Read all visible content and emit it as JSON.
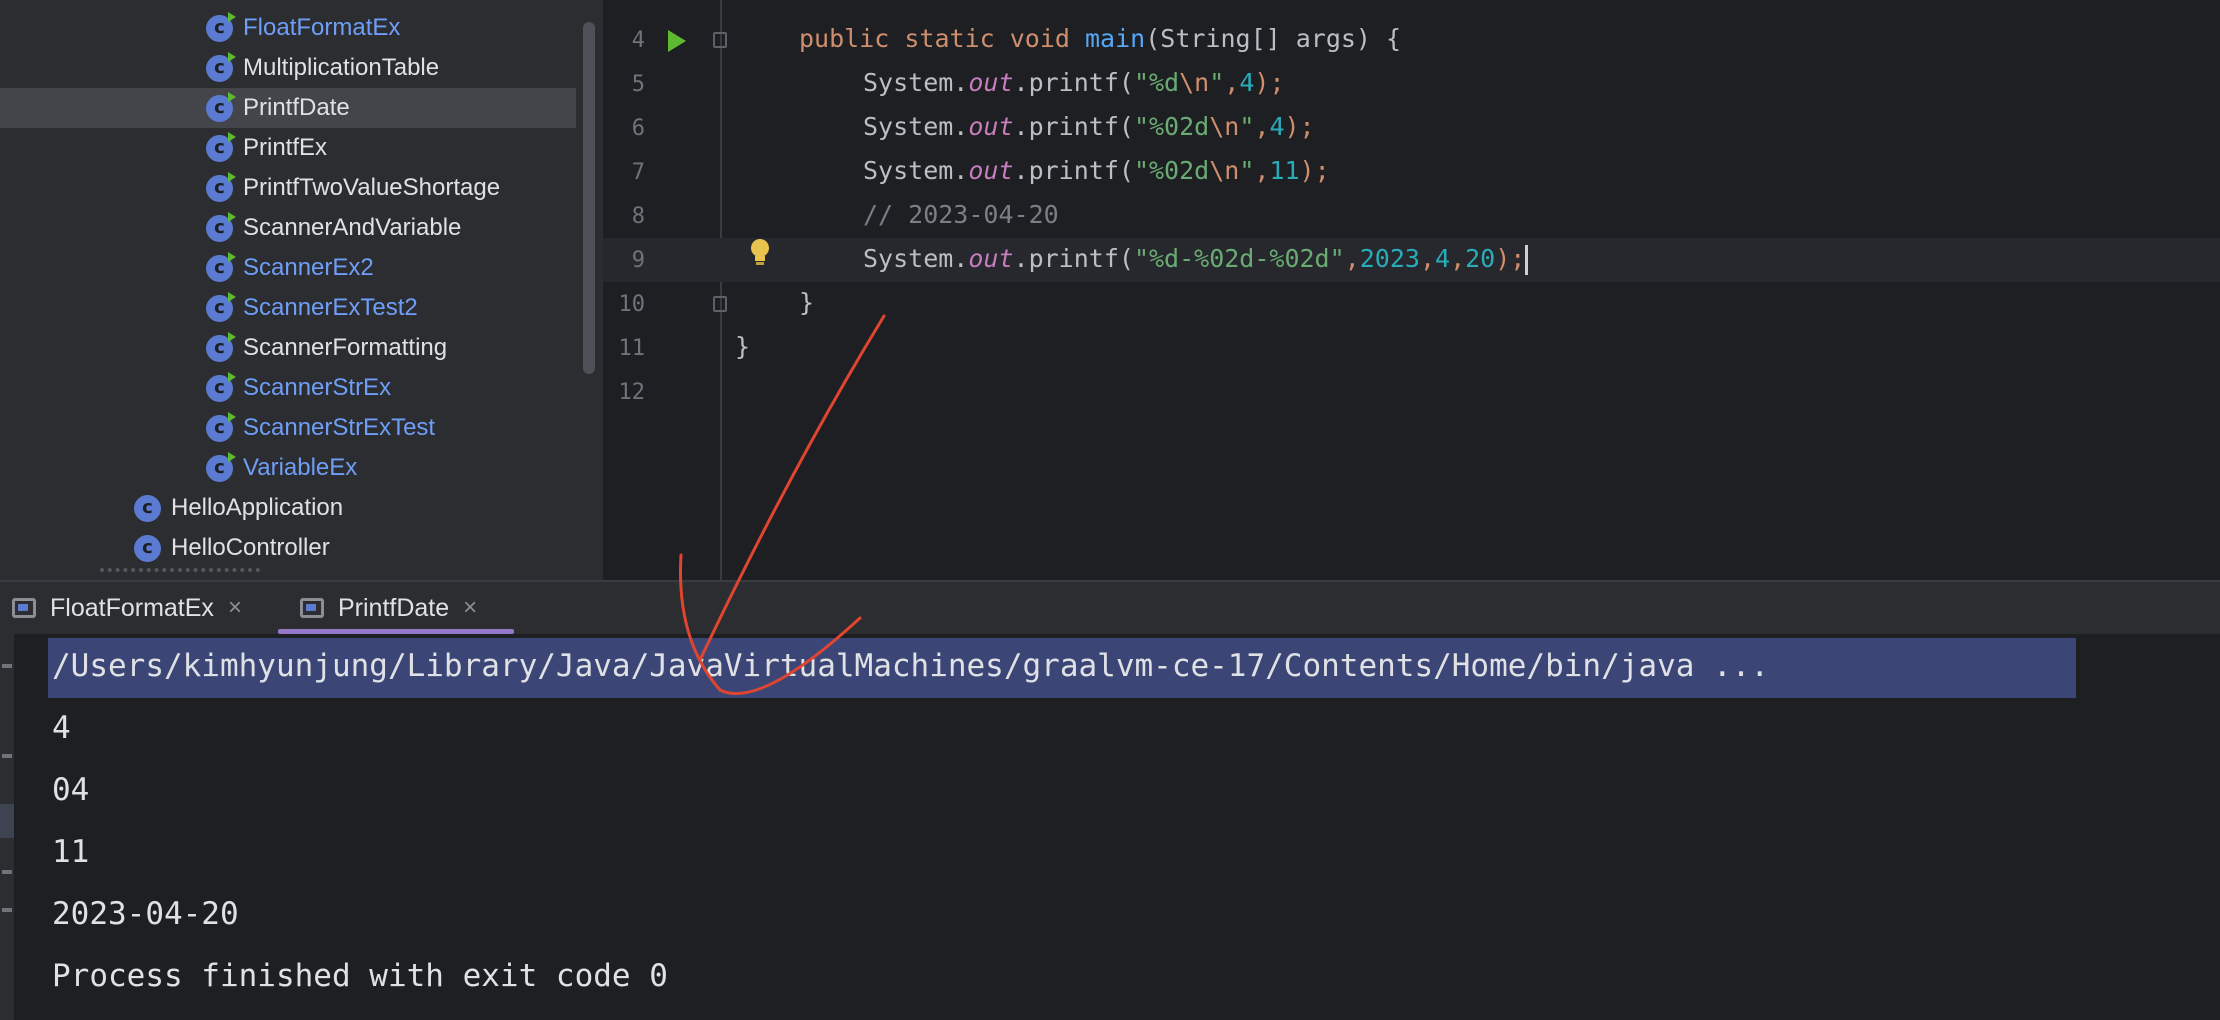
{
  "project_tree": {
    "items": [
      {
        "label": "FloatFormatEx",
        "color": "#6f9ef8",
        "runnable": true,
        "indent": 1
      },
      {
        "label": "MultiplicationTable",
        "color": "#dfe1e5",
        "runnable": true,
        "indent": 1
      },
      {
        "label": "PrintfDate",
        "color": "#dfe1e5",
        "runnable": true,
        "indent": 1,
        "selected": true
      },
      {
        "label": "PrintfEx",
        "color": "#dfe1e5",
        "runnable": true,
        "indent": 1
      },
      {
        "label": "PrintfTwoValueShortage",
        "color": "#dfe1e5",
        "runnable": true,
        "indent": 1
      },
      {
        "label": "ScannerAndVariable",
        "color": "#dfe1e5",
        "runnable": true,
        "indent": 1
      },
      {
        "label": "ScannerEx2",
        "color": "#6f9ef8",
        "runnable": true,
        "indent": 1
      },
      {
        "label": "ScannerExTest2",
        "color": "#6f9ef8",
        "runnable": true,
        "indent": 1
      },
      {
        "label": "ScannerFormatting",
        "color": "#dfe1e5",
        "runnable": true,
        "indent": 1
      },
      {
        "label": "ScannerStrEx",
        "color": "#6f9ef8",
        "runnable": true,
        "indent": 1
      },
      {
        "label": "ScannerStrExTest",
        "color": "#6f9ef8",
        "runnable": true,
        "indent": 1
      },
      {
        "label": "VariableEx",
        "color": "#6f9ef8",
        "runnable": true,
        "indent": 1
      },
      {
        "label": "HelloApplication",
        "color": "#dfe1e5",
        "runnable": false,
        "indent": 0
      },
      {
        "label": "HelloController",
        "color": "#dfe1e5",
        "runnable": false,
        "indent": 0
      }
    ]
  },
  "editor": {
    "line_numbers": [
      "4",
      "5",
      "6",
      "7",
      "8",
      "9",
      "10",
      "11",
      "12"
    ],
    "code": {
      "l4_kw": "public static void",
      "l4_fn": "main",
      "l4_rest": "(String[] args) {",
      "sysout": "System.",
      "out": "out",
      "printf": ".printf(",
      "l5_str": "\"%d",
      "l5_esc": "\\n",
      "l5_strend": "\"",
      "l5_num": "4",
      "l6_str": "\"%02d",
      "l6_num": "4",
      "l7_num": "11",
      "l8_comment": "// 2023-04-20",
      "l9_str": "\"%d-%02d-%02d\"",
      "l9_n1": "2023",
      "l9_n2": "4",
      "l9_n3": "20",
      "close_paren": ");",
      "comma": ",",
      "brace_close": "}"
    }
  },
  "run_tabs": [
    {
      "label": "FloatFormatEx",
      "close": "×"
    },
    {
      "label": "PrintfDate",
      "close": "×",
      "active": true
    }
  ],
  "console": {
    "command": "/Users/kimhyunjung/Library/Java/JavaVirtualMachines/graalvm-ce-17/Contents/Home/bin/java ...",
    "output": [
      "4",
      "04",
      "11",
      "2023-04-20"
    ],
    "exit_message": "Process finished with exit code 0"
  },
  "colors": {
    "accent_tab": "#9678c9",
    "selection": "#3b4676",
    "annotation": "#e0452f"
  }
}
